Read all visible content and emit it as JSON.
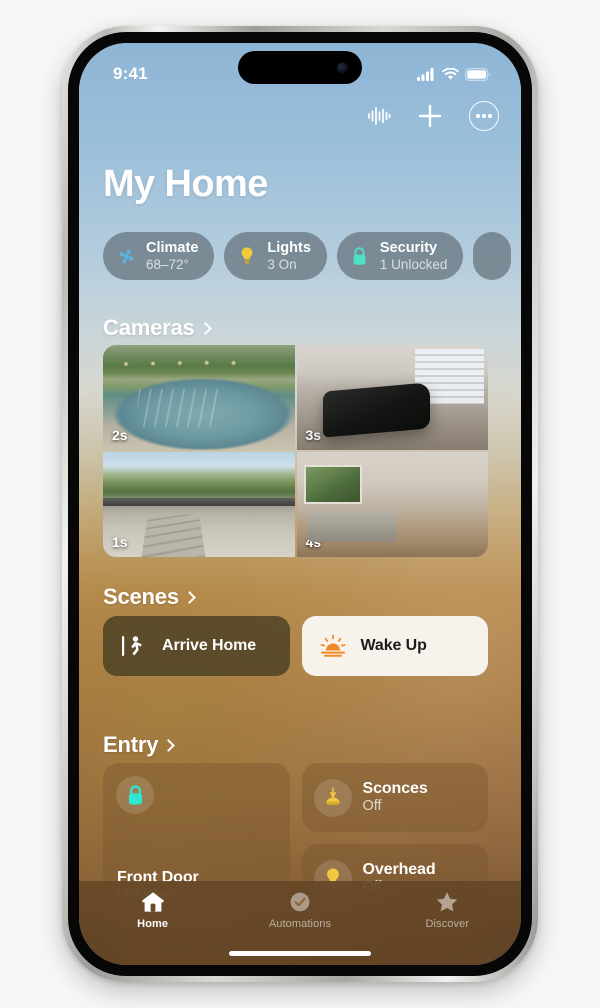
{
  "status_bar": {
    "time": "9:41",
    "cellular_icon": "cellular-bars-icon",
    "wifi_icon": "wifi-icon",
    "battery_icon": "battery-full-icon"
  },
  "toolbar": {
    "siri_label": "siri-waveform-icon",
    "add_label": "add-icon",
    "more_label": "more-options-icon"
  },
  "header": {
    "title": "My Home"
  },
  "status_pills": [
    {
      "id": "climate",
      "icon": "fan-icon",
      "title": "Climate",
      "subtitle": "68–72°",
      "color": "#5ab4ea"
    },
    {
      "id": "lights",
      "icon": "bulb-icon",
      "title": "Lights",
      "subtitle": "3 On",
      "color": "#f2c83c"
    },
    {
      "id": "security",
      "icon": "lock-icon",
      "title": "Security",
      "subtitle": "1 Unlocked",
      "color": "#4fe0c4"
    }
  ],
  "sections": {
    "cameras": {
      "title": "Cameras",
      "chevron": "chevron-right-icon"
    },
    "scenes": {
      "title": "Scenes",
      "chevron": "chevron-right-icon"
    },
    "entry": {
      "title": "Entry",
      "chevron": "chevron-right-icon"
    }
  },
  "cameras": [
    {
      "id": "pool",
      "timestamp": "2s",
      "scene": "backyard-pool"
    },
    {
      "id": "garage",
      "timestamp": "3s",
      "scene": "garage-gym"
    },
    {
      "id": "street",
      "timestamp": "1s",
      "scene": "driveway-street"
    },
    {
      "id": "living",
      "timestamp": "4s",
      "scene": "living-room"
    }
  ],
  "scenes": [
    {
      "id": "arrive-home",
      "label": "Arrive Home",
      "icon": "walking-person-door-icon",
      "style": "dark"
    },
    {
      "id": "wake-up",
      "label": "Wake Up",
      "icon": "sunrise-icon",
      "style": "light"
    }
  ],
  "entry_accessories": {
    "front_door": {
      "name": "Front Door",
      "state": "Unlocked",
      "icon": "lock-icon",
      "icon_color": "#2fe8d2"
    },
    "sconces": {
      "name": "Sconces",
      "state": "Off",
      "icon": "pendant-lamp-icon",
      "icon_color": "#f2c83c"
    },
    "overhead": {
      "name": "Overhead",
      "state": "Off",
      "icon": "bulb-icon",
      "icon_color": "#f2c83c"
    }
  },
  "tab_bar": [
    {
      "id": "home",
      "label": "Home",
      "icon": "house-icon",
      "active": true
    },
    {
      "id": "automations",
      "label": "Automations",
      "icon": "clock-check-icon",
      "active": false
    },
    {
      "id": "discover",
      "label": "Discover",
      "icon": "star-icon",
      "active": false
    }
  ],
  "colors": {
    "accent_yellow": "#f2c83c",
    "accent_teal": "#2fe8d2",
    "accent_blue": "#5ab4ea",
    "accent_orange": "#f08a24",
    "sky_top": "#8fb5d6",
    "warm_bottom": "#6f4d2c"
  }
}
